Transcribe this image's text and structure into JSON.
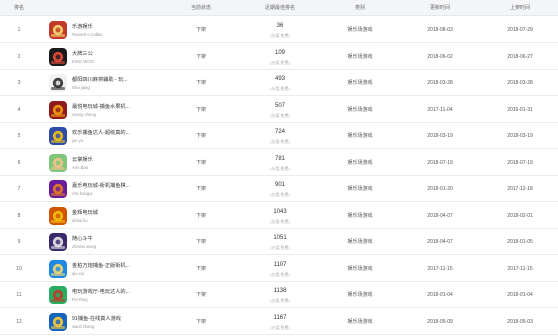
{
  "headers": {
    "rank": "排名",
    "status": "当前状态",
    "recent_rank": "近期最佳排名",
    "category": "类别",
    "updated": "更新时间",
    "launched": "上架时间"
  },
  "rows": [
    {
      "rank": "1",
      "name": "乐游娱乐",
      "developer": "Russell A Cabbo",
      "status": "下架",
      "best_rank": "36",
      "rank_note": "(分类:免费)",
      "category": "娱乐场游戏",
      "updated": "2018-08-03",
      "launched": "2018-07-29",
      "icon": "red-casino-icon",
      "colors": [
        "#c0392b",
        "#f5d76e"
      ]
    },
    {
      "rank": "2",
      "name": "大牌三公",
      "developer": "KING WOO",
      "status": "下架",
      "best_rank": "109",
      "rank_note": "(分类:免费)",
      "category": "娱乐场游戏",
      "updated": "2018-06-02",
      "launched": "2018-06-27",
      "icon": "black-card-icon",
      "colors": [
        "#1a1a1a",
        "#e74c3c"
      ]
    },
    {
      "rank": "3",
      "name": "都阳四川麻将辅助 - 玩...",
      "developer": "shei jiang",
      "status": "下架",
      "best_rank": "493",
      "rank_note": "(分类:免费)",
      "category": "娱乐场游戏",
      "updated": "2018-03-28",
      "launched": "2018-03-28",
      "icon": "panda-icon",
      "colors": [
        "#f2f2f2",
        "#2c2c2c"
      ]
    },
    {
      "rank": "4",
      "name": "最悦电玩城-捕鱼水果机...",
      "developer": "vuong cheng",
      "status": "下架",
      "best_rank": "507",
      "rank_note": "(分类:免费)",
      "category": "娱乐场游戏",
      "updated": "2017-11-04",
      "launched": "2016-01-31",
      "icon": "fruit-machine-icon",
      "colors": [
        "#8e1b1b",
        "#f39c12"
      ]
    },
    {
      "rank": "5",
      "name": "欢乐捕鱼达人-超级真的...",
      "developer": "jue yu",
      "status": "下架",
      "best_rank": "724",
      "rank_note": "(分类:免费)",
      "category": "娱乐场游戏",
      "updated": "2018-03-19",
      "launched": "2018-03-19",
      "icon": "fish-icon",
      "colors": [
        "#2e4ba8",
        "#f1c40f"
      ]
    },
    {
      "rank": "6",
      "name": "云掌娱乐",
      "developer": "Ann Bao",
      "status": "下架",
      "best_rank": "781",
      "rank_note": "(分类:免费)",
      "category": "娱乐场游戏",
      "updated": "2018-07-19",
      "launched": "2018-07-19",
      "icon": "character-icon",
      "colors": [
        "#7fc67a",
        "#f5c28a"
      ]
    },
    {
      "rank": "7",
      "name": "嘉乐电玩城-街机捕鱼棋...",
      "developer": "che bangui",
      "status": "下架",
      "best_rank": "901",
      "rank_note": "(分类:免费)",
      "category": "娱乐场游戏",
      "updated": "2018-01-20",
      "launched": "2017-12-18",
      "icon": "arcade-icon",
      "colors": [
        "#6a1b9a",
        "#e67e22"
      ]
    },
    {
      "rank": "8",
      "name": "金辉电玩城",
      "developer": "dehui liu",
      "status": "下架",
      "best_rank": "1043",
      "rank_note": "(分类:免费)",
      "category": "娱乐场游戏",
      "updated": "2018-04-07",
      "launched": "2018-02-01",
      "icon": "slot-777-icon",
      "colors": [
        "#d35400",
        "#f1c40f"
      ]
    },
    {
      "rank": "9",
      "name": "随心斗牛",
      "developer": "zhewei xiang",
      "status": "下架",
      "best_rank": "1051",
      "rank_note": "(分类:免费)",
      "category": "娱乐场游戏",
      "updated": "2018-04-07",
      "launched": "2018-01-05",
      "icon": "bull-icon",
      "colors": [
        "#3b2a6b",
        "#e8e8e8"
      ]
    },
    {
      "rank": "10",
      "name": "金柏万炮捕鱼-正版街机...",
      "developer": "qiu xiu",
      "status": "下架",
      "best_rank": "1107",
      "rank_note": "(分类:免费)",
      "category": "娱乐场游戏",
      "updated": "2017-11-15",
      "launched": "2017-11-15",
      "icon": "cannon-fish-icon",
      "colors": [
        "#1e88e5",
        "#f5d76e"
      ]
    },
    {
      "rank": "11",
      "name": "电玩游戏厅-电玩达人的...",
      "developer": "Fei Ding",
      "status": "下架",
      "best_rank": "1138",
      "rank_note": "(分类:免费)",
      "category": "娱乐场游戏",
      "updated": "2018-01-04",
      "launched": "2018-01-04",
      "icon": "green-arcade-icon",
      "colors": [
        "#27ae60",
        "#c0392b"
      ]
    },
    {
      "rank": "12",
      "name": "91捕鱼-在线真人游戏",
      "developer": "xiaoli zhang",
      "status": "下架",
      "best_rank": "1167",
      "rank_note": "(分类:免费)",
      "category": "娱乐场游戏",
      "updated": "2018-05-09",
      "launched": "2018-05-03",
      "icon": "ocean-fish-icon",
      "colors": [
        "#1565c0",
        "#ffcc33"
      ]
    }
  ]
}
